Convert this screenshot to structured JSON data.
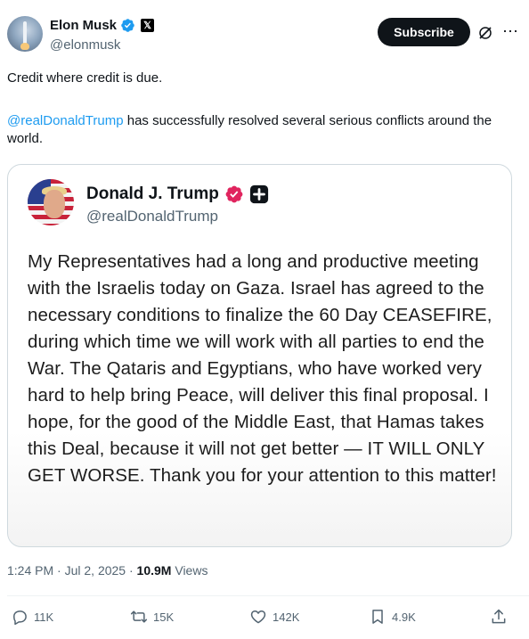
{
  "author": {
    "display_name": "Elon Musk",
    "handle": "@elonmusk"
  },
  "header": {
    "subscribe_label": "Subscribe",
    "more_icon": "ellipsis-icon",
    "grok_icon": "grok-icon"
  },
  "tweet": {
    "line1": "Credit where credit is due.",
    "mention": "@realDonaldTrump",
    "line2_rest": " has successfully resolved several serious conflicts around the world."
  },
  "quote": {
    "display_name": "Donald J. Trump",
    "handle": "@realDonaldTrump",
    "body": "My Representatives had a long and productive meeting with the Israelis today on Gaza. Israel has agreed to the necessary conditions to finalize the 60 Day CEASEFIRE, during which time we will work with all parties to end the War. The Qataris and Egyptians, who have worked very hard to help bring Peace, will deliver this final proposal. I hope, for the good of the Middle East, that Hamas takes this Deal, because it will not get better — IT WILL ONLY GET WORSE. Thank you for your attention to this matter!"
  },
  "meta": {
    "time": "1:24 PM",
    "separator": " · ",
    "date": "Jul 2, 2025",
    "views_count": "10.9M",
    "views_label": " Views"
  },
  "actions": {
    "replies": "11K",
    "reposts": "15K",
    "likes": "142K",
    "bookmarks": "4.9K"
  },
  "colors": {
    "accent": "#1d9bf0",
    "verified_blue": "#1d9bf0",
    "verified_pink": "#e0245e",
    "muted": "#536471"
  }
}
